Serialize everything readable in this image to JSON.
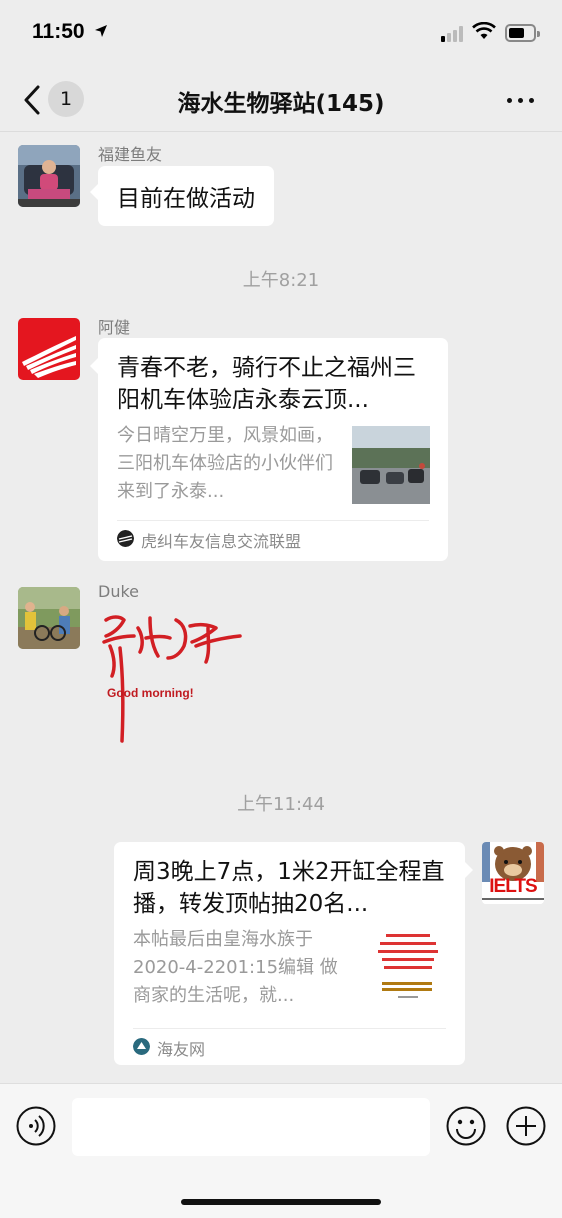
{
  "status": {
    "time": "11:50"
  },
  "header": {
    "badge_count": "1",
    "title": "海水生物驿站(145)"
  },
  "messages": [
    {
      "sender": "福建鱼友",
      "text": "目前在做活动"
    },
    {
      "timestamp": "上午8:21"
    },
    {
      "sender": "阿健",
      "card": {
        "title": "青春不老，骑行不止之福州三阳机车体验店永泰云顶...",
        "desc": "今日晴空万里，风景如画，三阳机车体验店的小伙伴们来到了永泰...",
        "source": "虎纠车友信息交流联盟"
      }
    },
    {
      "sender": "Duke",
      "sticker": {
        "text": "Good morning!"
      }
    },
    {
      "timestamp": "上午11:44"
    },
    {
      "self_card": {
        "title": "周3晚上7点，1米2开缸全程直播，转发顶帖抽20名...",
        "desc": "本帖最后由皇海水族于2020-4-2201:15编辑 做商家的生活呢，就...",
        "source": "海友网"
      },
      "avatar_text": "IELTS"
    }
  ],
  "icons": {
    "back": "chevron-left-icon",
    "more": "more-dots-icon",
    "voice": "voice-icon",
    "emoji": "emoji-icon",
    "add": "plus-circle-icon"
  },
  "colors": {
    "background": "#ededed",
    "bubble": "#ffffff",
    "sticker_red": "#d21f24"
  }
}
